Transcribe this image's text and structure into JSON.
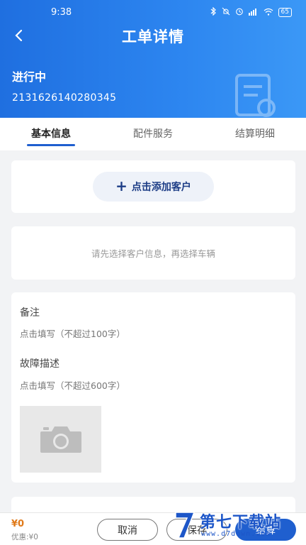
{
  "status_bar": {
    "time": "9:38",
    "battery": "65"
  },
  "header": {
    "title": "工单详情",
    "status": "进行中",
    "order_number": "2131626140280345"
  },
  "tabs": [
    {
      "label": "基本信息",
      "active": true
    },
    {
      "label": "配件服务",
      "active": false
    },
    {
      "label": "结算明细",
      "active": false
    }
  ],
  "customer": {
    "add_label": "点击添加客户"
  },
  "vehicle_hint": "请先选择客户信息，再选择车辆",
  "remark": {
    "label": "备注",
    "placeholder": "点击填写（不超过100字）"
  },
  "fault": {
    "label": "故障描述",
    "placeholder": "点击填写（不超过600字）"
  },
  "bottom": {
    "total": "¥0",
    "discount": "优惠:¥0",
    "cancel_label": "取消",
    "save_label": "保存",
    "settle_label": "结算"
  },
  "watermark": {
    "text": "第七下载站",
    "url": "www.d7down.com"
  },
  "colors": {
    "primary": "#1f5fcf",
    "header_start": "#1f6fe0",
    "header_end": "#3b98f6",
    "price": "#e07a1a"
  }
}
